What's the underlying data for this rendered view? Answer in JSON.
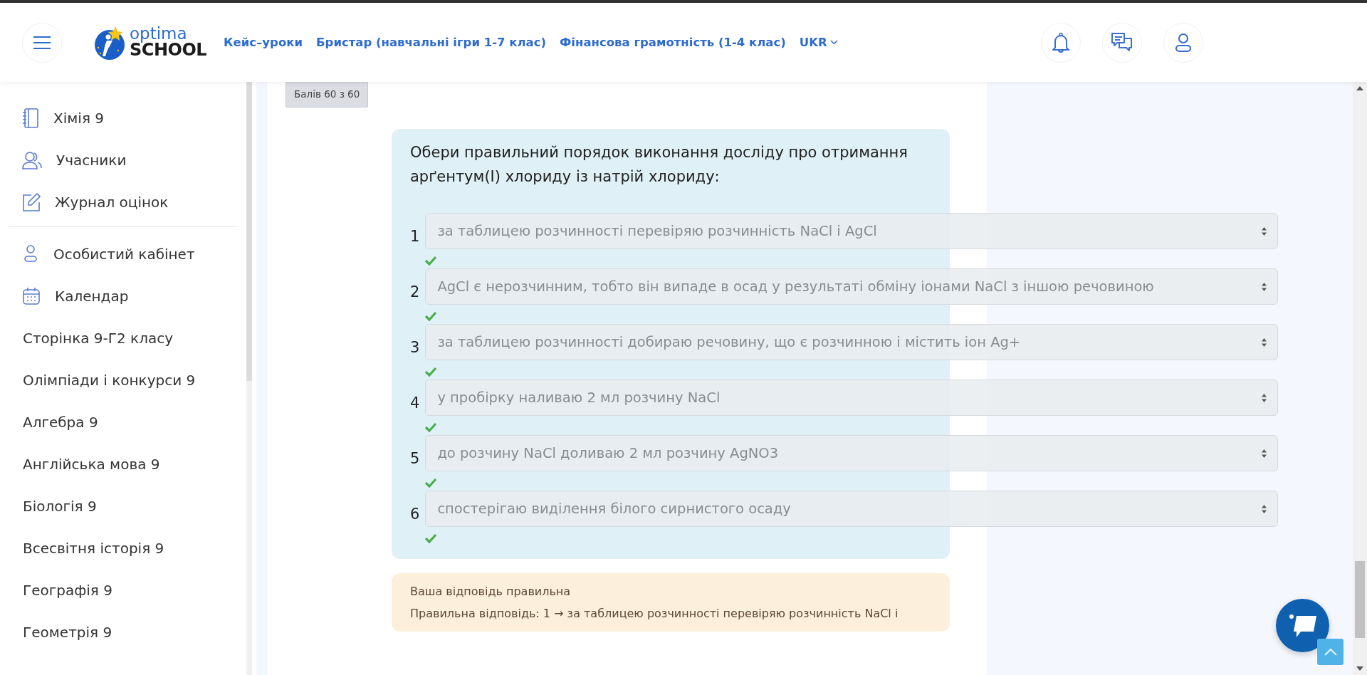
{
  "header": {
    "logo": {
      "top": "optima",
      "bottom": "SCHOOL"
    },
    "nav_links": [
      "Кейс–уроки",
      "Бристар (навчальні ігри 1-7 клас)",
      "Фінансова грамотність (1-4 клас)"
    ],
    "language": "UKR"
  },
  "sidebar": {
    "course_menu": [
      "Хімія 9",
      "Учасники",
      "Журнал оцінок"
    ],
    "personal_menu": [
      "Особистий кабінет",
      "Календар"
    ],
    "links": [
      "Сторінка 9-Г2 класу",
      "Олімпіади і конкурси 9",
      "Алгебра 9",
      "Англійська мова 9",
      "Біологія 9",
      "Всесвітня історія 9",
      "Географія 9",
      "Геометрія 9"
    ]
  },
  "score": "Балів 60 з 60",
  "question": {
    "text": "Обери правильний порядок виконання досліду про отримання арґентум(І) хлориду із натрій хлориду:",
    "items": [
      {
        "number": "1",
        "answer": "за таблицею розчинності перевіряю розчинність NaCl і AgCl",
        "correct": true
      },
      {
        "number": "2",
        "answer": "AgCl є нерозчинним, тобто він випаде в осад у результаті обміну іонами NaCl з іншою речовиною",
        "correct": true
      },
      {
        "number": "3",
        "answer": "за таблицею розчинності добираю речовину, що є розчинною і містить іон Ag+",
        "correct": true
      },
      {
        "number": "4",
        "answer": "у пробірку наливаю 2 мл розчину NaCl",
        "correct": true
      },
      {
        "number": "5",
        "answer": "до розчину NaCl доливаю 2 мл розчину AgNO3",
        "correct": true
      },
      {
        "number": "6",
        "answer": "спостерігаю виділення білого сирнистого осаду",
        "correct": true
      }
    ]
  },
  "feedback": {
    "title": "Ваша відповідь правильна",
    "answer": "Правильна відповідь: 1 → за таблицею розчинності перевіряю розчинність NaCl і"
  }
}
